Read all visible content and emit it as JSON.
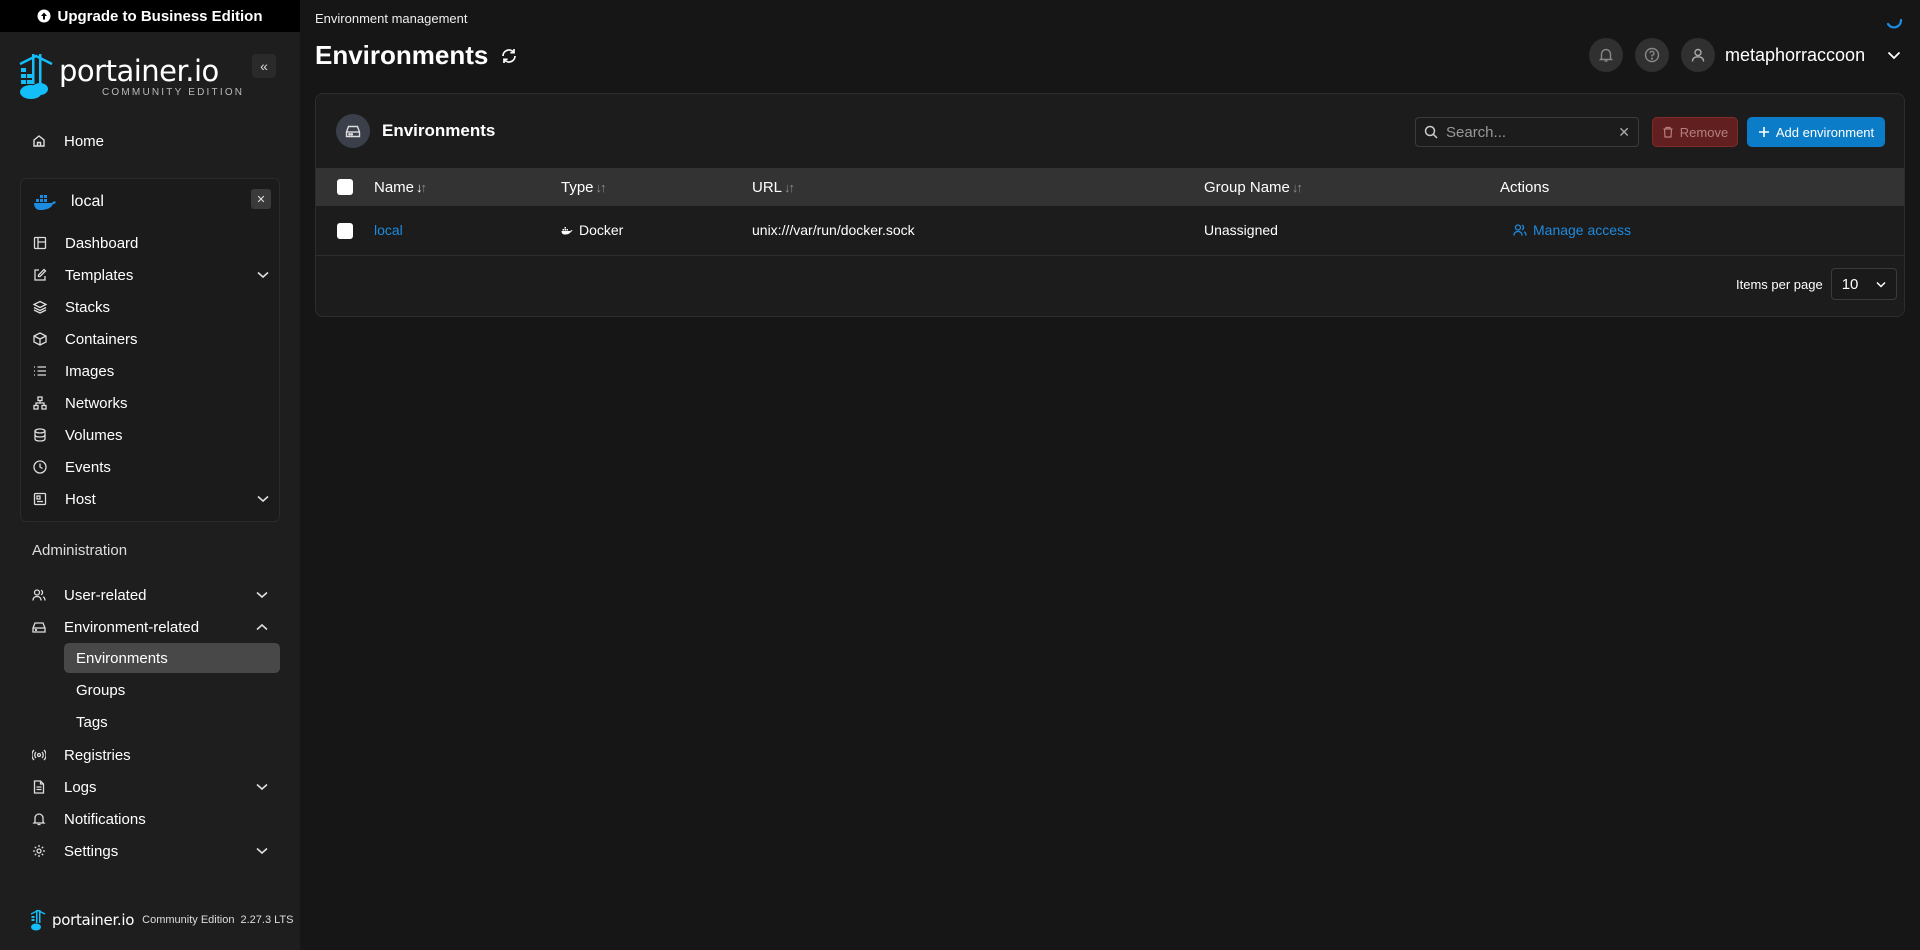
{
  "upgrade_banner": {
    "label": "Upgrade to Business Edition"
  },
  "brand": {
    "name": "portainer.io",
    "edition": "COMMUNITY EDITION"
  },
  "sidebar": {
    "home": "Home",
    "environment": {
      "name": "local",
      "items": [
        {
          "label": "Dashboard",
          "icon": "dashboard-icon"
        },
        {
          "label": "Templates",
          "icon": "edit-icon",
          "expandable": true
        },
        {
          "label": "Stacks",
          "icon": "layers-icon"
        },
        {
          "label": "Containers",
          "icon": "box-icon"
        },
        {
          "label": "Images",
          "icon": "list-icon"
        },
        {
          "label": "Networks",
          "icon": "network-icon"
        },
        {
          "label": "Volumes",
          "icon": "database-icon"
        },
        {
          "label": "Events",
          "icon": "clock-icon"
        },
        {
          "label": "Host",
          "icon": "host-icon",
          "expandable": true
        }
      ]
    },
    "administration": {
      "title": "Administration",
      "user_related": "User-related",
      "environment_related": "Environment-related",
      "sub_items": [
        "Environments",
        "Groups",
        "Tags"
      ],
      "registries": "Registries",
      "logs": "Logs",
      "notifications": "Notifications",
      "settings": "Settings"
    },
    "footer": {
      "name": "portainer.io",
      "edition": "Community Edition",
      "version": "2.27.3 LTS"
    }
  },
  "header": {
    "breadcrumb": "Environment management",
    "title": "Environments",
    "username": "metaphorraccoon"
  },
  "card": {
    "title": "Environments",
    "search_placeholder": "Search...",
    "remove_label": "Remove",
    "add_label": "Add environment",
    "columns": [
      "Name",
      "Type",
      "URL",
      "Group Name",
      "Actions"
    ],
    "rows": [
      {
        "name": "local",
        "type": "Docker",
        "url": "unix:///var/run/docker.sock",
        "group": "Unassigned",
        "action": "Manage access"
      }
    ],
    "items_per_page_label": "Items per page",
    "items_per_page": "10"
  },
  "colors": {
    "accent": "#0b7cc8",
    "link": "#1d8be0",
    "danger": "#7a2020",
    "background": "#161616",
    "sidebar": "#1e1e1e"
  }
}
